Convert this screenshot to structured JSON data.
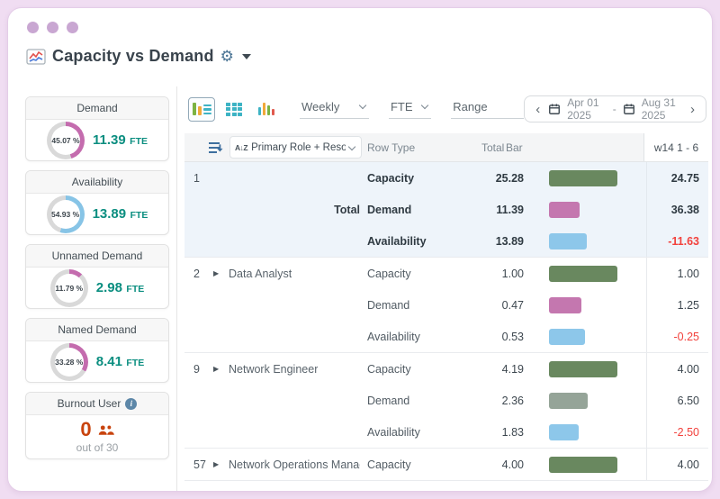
{
  "window": {
    "title": "Capacity vs Demand"
  },
  "colors": {
    "accent_teal": "#0b8e80",
    "burnout_orange": "#c8430d",
    "negative_red": "#f2413c",
    "highlight_row_bg": "#eef4fa",
    "page_bg": "#f0ddf2"
  },
  "sidebar": {
    "gauges": [
      {
        "label": "Demand",
        "pct": "45.07 %",
        "pct_value": 45.07,
        "value": "11.39",
        "unit": "FTE",
        "arc_color": "#c46cae"
      },
      {
        "label": "Availability",
        "pct": "54.93 %",
        "pct_value": 54.93,
        "value": "13.89",
        "unit": "FTE",
        "arc_color": "#87c4e6"
      },
      {
        "label": "Unnamed Demand",
        "pct": "11.79 %",
        "pct_value": 11.79,
        "value": "2.98",
        "unit": "FTE",
        "arc_color": "#c46cae"
      },
      {
        "label": "Named Demand",
        "pct": "33.28 %",
        "pct_value": 33.28,
        "value": "8.41",
        "unit": "FTE",
        "arc_color": "#c46cae"
      }
    ],
    "burnout": {
      "label": "Burnout User",
      "value": "0",
      "caption": "out of 30"
    }
  },
  "toolbar": {
    "selects": [
      {
        "value": "Weekly"
      },
      {
        "value": "FTE"
      },
      {
        "value": "Range"
      }
    ],
    "date_range": {
      "start": "Apr 01 2025",
      "separator": "-",
      "end": "Aug 31 2025"
    }
  },
  "table": {
    "group_by": "Primary Role + Resource...",
    "columns": {
      "row_type": "Row Type",
      "total": "Total",
      "bar": "Bar",
      "week": "w14 1 - 6"
    },
    "bar_colors": {
      "green": "#69885f",
      "pink": "#c477af",
      "blue": "#8dc7ea",
      "graygreen": "#95a498"
    },
    "groups": [
      {
        "id": "1",
        "name": "",
        "total_label": "Total",
        "highlight": true,
        "expandable": false,
        "rows": [
          {
            "type": "Capacity",
            "total": "25.28",
            "bar_color": "green",
            "bar_frac": 1.0,
            "week": "24.75"
          },
          {
            "type": "Demand",
            "total": "11.39",
            "bar_color": "pink",
            "bar_frac": 0.45,
            "week": "36.38"
          },
          {
            "type": "Availability",
            "total": "13.89",
            "bar_color": "blue",
            "bar_frac": 0.55,
            "week": "-11.63"
          }
        ]
      },
      {
        "id": "2",
        "name": "Data Analyst",
        "total_label": "",
        "highlight": false,
        "expandable": true,
        "rows": [
          {
            "type": "Capacity",
            "total": "1.00",
            "bar_color": "green",
            "bar_frac": 1.0,
            "week": "1.00"
          },
          {
            "type": "Demand",
            "total": "0.47",
            "bar_color": "pink",
            "bar_frac": 0.47,
            "week": "1.25"
          },
          {
            "type": "Availability",
            "total": "0.53",
            "bar_color": "blue",
            "bar_frac": 0.53,
            "week": "-0.25"
          }
        ]
      },
      {
        "id": "9",
        "name": "Network Engineer",
        "total_label": "",
        "highlight": false,
        "expandable": true,
        "rows": [
          {
            "type": "Capacity",
            "total": "4.19",
            "bar_color": "green",
            "bar_frac": 1.0,
            "week": "4.00"
          },
          {
            "type": "Demand",
            "total": "2.36",
            "bar_color": "graygreen",
            "bar_frac": 0.56,
            "week": "6.50"
          },
          {
            "type": "Availability",
            "total": "1.83",
            "bar_color": "blue",
            "bar_frac": 0.44,
            "week": "-2.50"
          }
        ]
      },
      {
        "id": "57",
        "name": "Network Operations Manager",
        "total_label": "",
        "highlight": false,
        "expandable": true,
        "rows": [
          {
            "type": "Capacity",
            "total": "4.00",
            "bar_color": "green",
            "bar_frac": 1.0,
            "week": "4.00"
          }
        ]
      }
    ]
  }
}
